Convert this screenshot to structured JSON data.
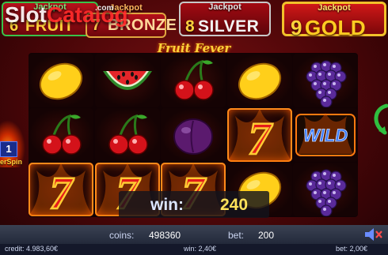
{
  "jackpots": [
    {
      "label": "Jackpot",
      "number": "6",
      "name": "FRUIT"
    },
    {
      "label": "Jackpot",
      "number": "7",
      "name": "BRONZE"
    },
    {
      "label": "Jackpot",
      "number": "8",
      "name": "SILVER"
    },
    {
      "label": "Jackpot",
      "number": "9",
      "name": "GOLD"
    }
  ],
  "watermark": {
    "brand_a": "Slot",
    "brand_b": "Catalog",
    "suffix": ".com"
  },
  "game_title": "Fruit Fever",
  "reels": {
    "rows": [
      [
        "lemon",
        "watermelon",
        "cherries",
        "lemon",
        "grapes"
      ],
      [
        "cherries",
        "cherries",
        "plum",
        "seven",
        "wild"
      ],
      [
        "seven",
        "seven",
        "seven",
        "lemon",
        "grapes"
      ]
    ],
    "wild_text": "WILD",
    "seven_text": "7",
    "winning_cells": [
      [
        1,
        3
      ],
      [
        2,
        0
      ],
      [
        2,
        1
      ],
      [
        2,
        2
      ]
    ]
  },
  "superspin": {
    "badge": "1",
    "label": "erSpin"
  },
  "win_bar": {
    "label": "win:",
    "amount": "240"
  },
  "bottom": {
    "coins_label": "coins:",
    "coins_value": "498360",
    "bet_label": "bet:",
    "bet_value": "200",
    "credit_text": "credit: 4.983,60€",
    "win_text": "win: 2,40€",
    "bet_text": "bet: 2,00€"
  },
  "colors": {
    "accent_gold": "#ffd23a",
    "background_red": "#4a0608",
    "bar_blue": "#3a4253"
  },
  "icons": {
    "sound": "speaker-muted-icon",
    "spin": "spin-arrow-icon"
  }
}
